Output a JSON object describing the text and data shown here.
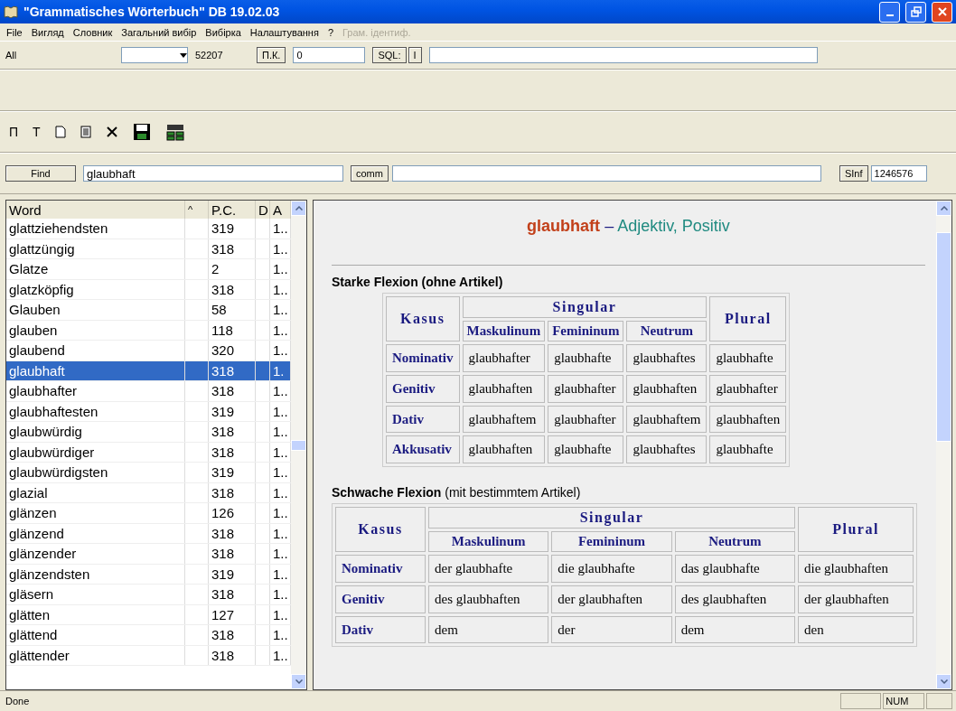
{
  "window": {
    "title": "\"Grammatisches Wörterbuch\" DB 19.02.03"
  },
  "menu": [
    {
      "label": "File",
      "disabled": false
    },
    {
      "label": "Вигляд",
      "disabled": false
    },
    {
      "label": "Словник",
      "disabled": false
    },
    {
      "label": "Загальний вибір",
      "disabled": false
    },
    {
      "label": "Вибірка",
      "disabled": false
    },
    {
      "label": "Налаштування",
      "disabled": false
    },
    {
      "label": "?",
      "disabled": false
    },
    {
      "label": "Грам. ідентиф.",
      "disabled": true
    }
  ],
  "toolbar": {
    "filter_label": "All",
    "count": "52207",
    "pk_button": "П.К.",
    "pk_value": "0",
    "sql_button": "SQL:",
    "i_button": "I"
  },
  "icon_toolbar": [
    {
      "kind": "text",
      "label": "П"
    },
    {
      "kind": "text",
      "label": "T"
    },
    {
      "kind": "new"
    },
    {
      "kind": "note"
    },
    {
      "kind": "delete"
    },
    {
      "kind": "save"
    },
    {
      "kind": "classes"
    }
  ],
  "search": {
    "button": "Find",
    "value": "glaubhaft",
    "comm_button": "comm",
    "sinf_button": "SInf",
    "sinf_value": "1246576"
  },
  "word_list": {
    "columns": [
      "Word",
      "^",
      "P.C.",
      "D",
      "A"
    ],
    "rows": [
      {
        "word": "glattziehendsten",
        "pc": "319",
        "a": "1..",
        "selected": false
      },
      {
        "word": "glattzüngig",
        "pc": "318",
        "a": "1..",
        "selected": false
      },
      {
        "word": "Glatze",
        "pc": "2",
        "a": "1..",
        "selected": false
      },
      {
        "word": "glatzköpfig",
        "pc": "318",
        "a": "1..",
        "selected": false
      },
      {
        "word": "Glauben",
        "pc": "58",
        "a": "1..",
        "selected": false
      },
      {
        "word": "glauben",
        "pc": "118",
        "a": "1..",
        "selected": false
      },
      {
        "word": "glaubend",
        "pc": "320",
        "a": "1..",
        "selected": false
      },
      {
        "word": "glaubhaft",
        "pc": "318",
        "a": "1.",
        "selected": true
      },
      {
        "word": "glaubhafter",
        "pc": "318",
        "a": "1..",
        "selected": false
      },
      {
        "word": "glaubhaftesten",
        "pc": "319",
        "a": "1..",
        "selected": false
      },
      {
        "word": "glaubwürdig",
        "pc": "318",
        "a": "1..",
        "selected": false
      },
      {
        "word": "glaubwürdiger",
        "pc": "318",
        "a": "1..",
        "selected": false
      },
      {
        "word": "glaubwürdigsten",
        "pc": "319",
        "a": "1..",
        "selected": false
      },
      {
        "word": "glazial",
        "pc": "318",
        "a": "1..",
        "selected": false
      },
      {
        "word": "glänzen",
        "pc": "126",
        "a": "1..",
        "selected": false
      },
      {
        "word": "glänzend",
        "pc": "318",
        "a": "1..",
        "selected": false
      },
      {
        "word": "glänzender",
        "pc": "318",
        "a": "1..",
        "selected": false
      },
      {
        "word": "glänzendsten",
        "pc": "319",
        "a": "1..",
        "selected": false
      },
      {
        "word": "gläsern",
        "pc": "318",
        "a": "1..",
        "selected": false
      },
      {
        "word": "glätten",
        "pc": "127",
        "a": "1..",
        "selected": false
      },
      {
        "word": "glättend",
        "pc": "318",
        "a": "1..",
        "selected": false
      },
      {
        "word": "glättender",
        "pc": "318",
        "a": "1..",
        "selected": false
      }
    ]
  },
  "entry": {
    "headword": "glaubhaft",
    "dash": "–",
    "description": "Adjektiv, Positiv",
    "tables": [
      {
        "title": "**Starke Flexion (ohne Artikel)**",
        "kasus": "Kasus",
        "singular": "Singular",
        "plural": "Plural",
        "genders": [
          "Maskulinum",
          "Femininum",
          "Neutrum"
        ],
        "rows": [
          {
            "case": "Nominativ",
            "cells": [
              "glaubhafter",
              "glaubhafte",
              "glaubhaftes",
              "glaubhafte"
            ]
          },
          {
            "case": "Genitiv",
            "cells": [
              "glaubhaften",
              "glaubhafter",
              "glaubhaften",
              "glaubhafter"
            ]
          },
          {
            "case": "Dativ",
            "cells": [
              "glaubhaftem",
              "glaubhafter",
              "glaubhaftem",
              "glaubhaften"
            ]
          },
          {
            "case": "Akkusativ",
            "cells": [
              "glaubhaften",
              "glaubhafte",
              "glaubhaftes",
              "glaubhafte"
            ]
          }
        ]
      },
      {
        "title": "**Schwache Flexion** (mit bestimmtem Artikel)",
        "kasus": "Kasus",
        "singular": "Singular",
        "plural": "Plural",
        "genders": [
          "Maskulinum",
          "Femininum",
          "Neutrum"
        ],
        "rows": [
          {
            "case": "Nominativ",
            "cells": [
              "der glaubhafte",
              "die glaubhafte",
              "das glaubhafte",
              "die glaubhaften"
            ]
          },
          {
            "case": "Genitiv",
            "cells": [
              "des glaubhaften",
              "der glaubhaften",
              "des glaubhaften",
              "der glaubhaften"
            ]
          },
          {
            "case": "Dativ",
            "cells": [
              "dem",
              "der",
              "dem",
              "den"
            ]
          }
        ]
      }
    ]
  },
  "status_bar": {
    "text": "Done",
    "num": "NUM"
  }
}
